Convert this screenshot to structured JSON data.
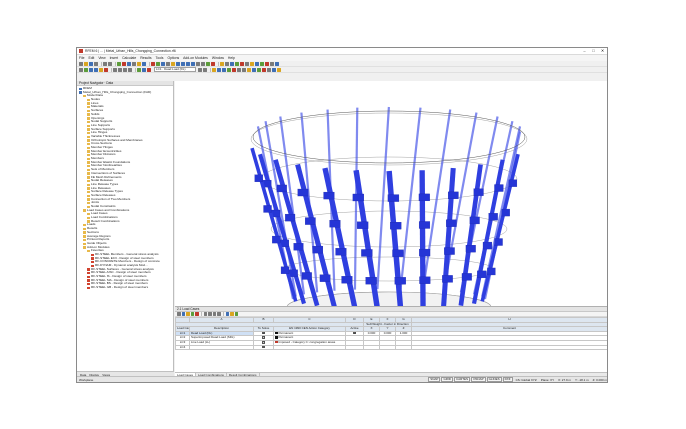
{
  "window": {
    "title": "RFEM 6 | ... | Metal_Urban_Hills_Chongqing_Connection.rf6",
    "min": "–",
    "max": "□",
    "close": "✕"
  },
  "menu": [
    "File",
    "Edit",
    "View",
    "Insert",
    "Calculate",
    "Results",
    "Tools",
    "Options",
    "Add-on Modules",
    "Window",
    "Help"
  ],
  "toolbar": {
    "load_case": "LC1 · Dead Load (DL)"
  },
  "navigator": {
    "header": "Project Navigator · Data",
    "items": [
      {
        "level": 0,
        "icon": "d",
        "label": "RFEM"
      },
      {
        "level": 0,
        "icon": "d",
        "label": "Metal_Urban_Hills_Chongqing_Connection (FAD)"
      },
      {
        "level": 1,
        "icon": "f",
        "label": "Model Data"
      },
      {
        "level": 2,
        "icon": "f",
        "label": "Nodes"
      },
      {
        "level": 2,
        "icon": "f",
        "label": "Lines"
      },
      {
        "level": 2,
        "icon": "f",
        "label": "Materials"
      },
      {
        "level": 2,
        "icon": "f",
        "label": "Surfaces"
      },
      {
        "level": 2,
        "icon": "f",
        "label": "Solids"
      },
      {
        "level": 2,
        "icon": "f",
        "label": "Openings"
      },
      {
        "level": 2,
        "icon": "f",
        "label": "Nodal Supports"
      },
      {
        "level": 2,
        "icon": "f",
        "label": "Line Supports"
      },
      {
        "level": 2,
        "icon": "f",
        "label": "Surface Supports"
      },
      {
        "level": 2,
        "icon": "f",
        "label": "Line Hinges"
      },
      {
        "level": 2,
        "icon": "f",
        "label": "Variable Thicknesses"
      },
      {
        "level": 2,
        "icon": "f",
        "label": "Orthotropic Surfaces and Membranes"
      },
      {
        "level": 2,
        "icon": "f",
        "label": "Cross-Sections"
      },
      {
        "level": 2,
        "icon": "f",
        "label": "Member Hinges"
      },
      {
        "level": 2,
        "icon": "f",
        "label": "Member Eccentricities"
      },
      {
        "level": 2,
        "icon": "f",
        "label": "Member Divisions"
      },
      {
        "level": 2,
        "icon": "f",
        "label": "Members"
      },
      {
        "level": 2,
        "icon": "f",
        "label": "Member Elastic Foundations"
      },
      {
        "level": 2,
        "icon": "f",
        "label": "Member Nonlinearities"
      },
      {
        "level": 2,
        "icon": "f",
        "label": "Sets of Members"
      },
      {
        "level": 2,
        "icon": "f",
        "label": "Intersections of Surfaces"
      },
      {
        "level": 2,
        "icon": "f",
        "label": "FE Mesh Refinements"
      },
      {
        "level": 2,
        "icon": "f",
        "label": "Nodal Releases"
      },
      {
        "level": 2,
        "icon": "f",
        "label": "Line Release Types"
      },
      {
        "level": 2,
        "icon": "f",
        "label": "Line Releases"
      },
      {
        "level": 2,
        "icon": "f",
        "label": "Surface Release Types"
      },
      {
        "level": 2,
        "icon": "f",
        "label": "Surface Releases"
      },
      {
        "level": 2,
        "icon": "f",
        "label": "Connection of Two Members"
      },
      {
        "level": 2,
        "icon": "f",
        "label": "Joints"
      },
      {
        "level": 2,
        "icon": "f",
        "label": "Nodal Constraints"
      },
      {
        "level": 1,
        "icon": "f",
        "label": "Load Cases and Combinations"
      },
      {
        "level": 2,
        "icon": "f",
        "label": "Load Cases"
      },
      {
        "level": 2,
        "icon": "f",
        "label": "Load Combinations"
      },
      {
        "level": 2,
        "icon": "f",
        "label": "Result Combinations"
      },
      {
        "level": 1,
        "icon": "f",
        "label": "Loads"
      },
      {
        "level": 1,
        "icon": "f",
        "label": "Results"
      },
      {
        "level": 1,
        "icon": "f",
        "label": "Sections"
      },
      {
        "level": 1,
        "icon": "f",
        "label": "Average Regions"
      },
      {
        "level": 1,
        "icon": "f",
        "label": "Printout Reports"
      },
      {
        "level": 1,
        "icon": "f",
        "label": "Guide Objects"
      },
      {
        "level": 1,
        "icon": "f",
        "label": "Add-on Modules"
      },
      {
        "level": 2,
        "icon": "f",
        "label": "Favorites"
      },
      {
        "level": 3,
        "icon": "o",
        "label": "RF-STEEL Members - General stress analysis"
      },
      {
        "level": 3,
        "icon": "o",
        "label": "RF-STEEL EC3 - Design of steel members"
      },
      {
        "level": 3,
        "icon": "o",
        "label": "RF-CONCRETE Members - Design of concrete"
      },
      {
        "level": 3,
        "icon": "o",
        "label": "RF-DYNAM - Dynamic analysis Mod..."
      },
      {
        "level": 2,
        "icon": "o",
        "label": "RF-STEEL Surfaces - General stress analysis"
      },
      {
        "level": 2,
        "icon": "o",
        "label": "RF-STEEL AISC - Design of steel members"
      },
      {
        "level": 2,
        "icon": "o",
        "label": "RF-STEEL IS - Design of steel members"
      },
      {
        "level": 2,
        "icon": "o",
        "label": "RF-STEEL SIA - Design of steel members"
      },
      {
        "level": 2,
        "icon": "o",
        "label": "RF-STEEL BS - Design of steel members"
      },
      {
        "level": 2,
        "icon": "o",
        "label": "RF-STEEL GB - Design of steel members"
      }
    ],
    "tabs": [
      "Data",
      "Display",
      "Views"
    ]
  },
  "tables": {
    "header": "2.1 Load Cases",
    "col_letters": [
      "A",
      "B",
      "C",
      "D",
      "E",
      "F",
      "G",
      "H"
    ],
    "columns": [
      "Load Case",
      "Description",
      "To Solve",
      "EN 1990 CEN Action Category",
      "Active",
      "X",
      "Y",
      "Z",
      "Comment"
    ],
    "group_header": "Self-Weight - Factor in Direction",
    "rows": [
      {
        "lc": "LC1",
        "desc": "Dead Load (DL)",
        "solve": "✓",
        "color": "#111111",
        "cat": "Permanent",
        "active": "✓",
        "x": "0.000",
        "y": "0.000",
        "z": "1.000",
        "comment": ""
      },
      {
        "lc": "LC2",
        "desc": "Superimposed Dead Load (SDL)",
        "solve": "✓",
        "color": "#111111",
        "cat": "Permanent",
        "active": "",
        "x": "",
        "y": "",
        "z": "",
        "comment": ""
      },
      {
        "lc": "LC3",
        "desc": "Live Load (LL)",
        "solve": "✓",
        "color": "#c0392b",
        "cat": "Imposed - Category C: congregation areas",
        "active": "",
        "x": "",
        "y": "",
        "z": "",
        "comment": ""
      },
      {
        "lc": "LC4",
        "desc": "",
        "solve": "",
        "color": "",
        "cat": "",
        "active": "",
        "x": "",
        "y": "",
        "z": "",
        "comment": ""
      }
    ],
    "sheet_tabs": [
      "Load Cases",
      "Load Combinations",
      "Result Combinations"
    ]
  },
  "statusbar": {
    "left": "Workplane",
    "pills": [
      "SNAP",
      "GRID",
      "CARTES",
      "OSNAP",
      "GLINES",
      "DXF"
    ],
    "cs": "CS: Global XYZ",
    "plane": "Plane: XY",
    "x": "X: 27.9 m",
    "y": "Y: -18.1 m",
    "z": "Z: 0.000 m"
  },
  "colors": {
    "members": "#2f3fe0",
    "ring": "#d9d9d9",
    "accent_red": "#c0392b"
  }
}
